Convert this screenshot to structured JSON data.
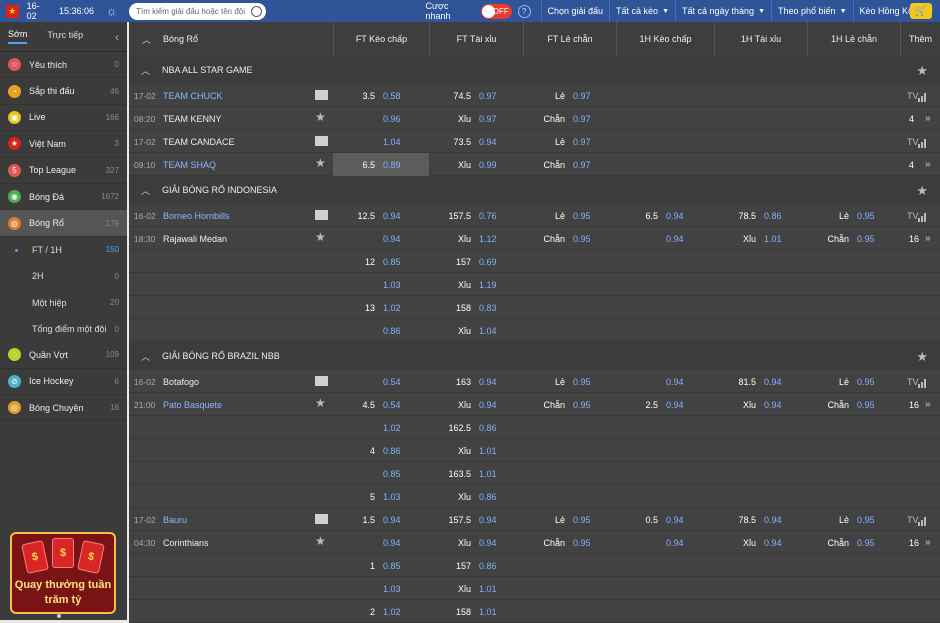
{
  "topbar": {
    "date": "16-02",
    "time": "15:36:06",
    "search_placeholder": "Tìm kiếm giải đấu hoặc tên đội",
    "quick_bet_label": "Cược nhanh",
    "toggle_state": "OFF",
    "menu": [
      {
        "label": "Chọn giải đấu",
        "caret": false
      },
      {
        "label": "Tất cả kèo",
        "caret": true
      },
      {
        "label": "Tất cả ngày tháng",
        "caret": true
      },
      {
        "label": "Theo phổ biến",
        "caret": true
      },
      {
        "label": "Kèo Hồng Kông",
        "caret": true
      }
    ]
  },
  "sidebar": {
    "tabs": [
      "Sớm",
      "Trực tiếp"
    ],
    "items": [
      {
        "label": "Yêu thích",
        "count": "0",
        "icon": "star-icon",
        "color": "#e05656"
      },
      {
        "label": "Sắp thi đấu",
        "count": "46",
        "icon": "clock-icon",
        "color": "#e5a31f"
      },
      {
        "label": "Live",
        "count": "166",
        "icon": "tv-icon",
        "color": "#e6c419"
      },
      {
        "label": "Việt Nam",
        "count": "3",
        "icon": "vietnam-flag-icon",
        "color": "#d8231a"
      },
      {
        "label": "Top League",
        "count": "327",
        "icon": "top-league-icon",
        "color": "#e05656"
      },
      {
        "label": "Bóng Đá",
        "count": "1672",
        "icon": "football-icon",
        "color": "#4caf50"
      },
      {
        "label": "Bóng Rổ",
        "count": "179",
        "icon": "basketball-icon",
        "color": "#e07a30"
      }
    ],
    "subitems": [
      {
        "label": "FT / 1H",
        "count": "150",
        "active": true
      },
      {
        "label": "2H",
        "count": "0",
        "active": false
      },
      {
        "label": "Một hiệp",
        "count": "20",
        "active": false
      },
      {
        "label": "Tổng điểm một đội",
        "count": "0",
        "active": false
      }
    ],
    "items2": [
      {
        "label": "Quần Vợt",
        "count": "109",
        "icon": "tennis-icon",
        "color": "#b8d430"
      },
      {
        "label": "Ice Hockey",
        "count": "6",
        "icon": "ice-hockey-icon",
        "color": "#4cb3c9"
      },
      {
        "label": "Bóng Chuyền",
        "count": "16",
        "icon": "volleyball-icon",
        "color": "#e0a030"
      }
    ],
    "promo": {
      "line1": "Quay thưởng tuần",
      "line2": "trăm tỷ",
      "env_symbol": "$"
    }
  },
  "headers": {
    "sport": "Bóng Rổ",
    "cols": [
      "FT Kèo chấp",
      "FT Tài xỉu",
      "FT Lẻ chẵn",
      "1H Kèo chấp",
      "1H Tài xỉu",
      "1H Lẻ chẵn",
      "Thêm"
    ]
  },
  "leagues": [
    {
      "name": "NBA ALL STAR GAME"
    },
    {
      "name": "GIẢI BÓNG RỔ INDONESIA"
    },
    {
      "name": "GIẢI BÓNG RỔ BRAZIL NBB"
    }
  ],
  "matches": [
    {
      "date": "17-02",
      "time": "08:20",
      "home": "TEAM CHUCK",
      "away": "TEAM KENNY",
      "home_fav": true,
      "away_fav": false,
      "more_count": "4",
      "rows": [
        {
          "hc": "3.5",
          "hco": "0.58",
          "ou": "74.5",
          "ouo": "0.97",
          "oe": "Lẻ",
          "oeo": "0.97"
        },
        {
          "hc": "",
          "hco": "0.96",
          "ou": "Xỉu",
          "ouo": "0.97",
          "oe": "Chẵn",
          "oeo": "0.97"
        }
      ]
    },
    {
      "date": "17-02",
      "time": "09:10",
      "home": "TEAM CANDACE",
      "away": "TEAM SHAQ",
      "home_fav": false,
      "away_fav": true,
      "more_count": "4",
      "rows": [
        {
          "hc": "",
          "hco": "1.04",
          "ou": "73.5",
          "ouo": "0.94",
          "oe": "Lẻ",
          "oeo": "0.97"
        },
        {
          "hc": "6.5",
          "hco": "0.89",
          "ou": "Xỉu",
          "ouo": "0.99",
          "oe": "Chẵn",
          "oeo": "0.97",
          "highlight": true
        }
      ]
    },
    {
      "date": "16-02",
      "time": "18:30",
      "home": "Borneo Hornbills",
      "away": "Rajawali Medan",
      "home_fav": true,
      "away_fav": false,
      "more_count": "16",
      "rows": [
        {
          "hc": "12.5",
          "hco": "0.94",
          "ou": "157.5",
          "ouo": "0.76",
          "oe": "Lẻ",
          "oeo": "0.95",
          "h1hc": "6.5",
          "h1hco": "0.94",
          "h1ou": "78.5",
          "h1ouo": "0.86",
          "h1oe": "Lẻ",
          "h1oeo": "0.95"
        },
        {
          "hc": "",
          "hco": "0.94",
          "ou": "Xỉu",
          "ouo": "1.12",
          "oe": "Chẵn",
          "oeo": "0.95",
          "h1hc": "",
          "h1hco": "0.94",
          "h1ou": "Xỉu",
          "h1ouo": "1.01",
          "h1oe": "Chẵn",
          "h1oeo": "0.95"
        },
        {
          "hc": "12",
          "hco": "0.85",
          "ou": "157",
          "ouo": "0.69"
        },
        {
          "hc": "",
          "hco": "1.03",
          "ou": "Xỉu",
          "ouo": "1.19"
        },
        {
          "hc": "13",
          "hco": "1.02",
          "ou": "158",
          "ouo": "0.83"
        },
        {
          "hc": "",
          "hco": "0.86",
          "ou": "Xỉu",
          "ouo": "1.04"
        }
      ]
    },
    {
      "date": "16-02",
      "time": "21:00",
      "home": "Botafogo",
      "away": "Pato Basquete",
      "home_fav": false,
      "away_fav": true,
      "more_count": "16",
      "rows": [
        {
          "hc": "",
          "hco": "0.54",
          "ou": "163",
          "ouo": "0.94",
          "oe": "Lẻ",
          "oeo": "0.95",
          "h1hc": "",
          "h1hco": "0.94",
          "h1ou": "81.5",
          "h1ouo": "0.94",
          "h1oe": "Lẻ",
          "h1oeo": "0.95"
        },
        {
          "hc": "4.5",
          "hco": "0.54",
          "ou": "Xỉu",
          "ouo": "0.94",
          "oe": "Chẵn",
          "oeo": "0.95",
          "h1hc": "2.5",
          "h1hco": "0.94",
          "h1ou": "Xỉu",
          "h1ouo": "0.94",
          "h1oe": "Chẵn",
          "h1oeo": "0.95"
        },
        {
          "hc": "",
          "hco": "1.02",
          "ou": "162.5",
          "ouo": "0.86"
        },
        {
          "hc": "4",
          "hco": "0.86",
          "ou": "Xỉu",
          "ouo": "1.01"
        },
        {
          "hc": "",
          "hco": "0.85",
          "ou": "163.5",
          "ouo": "1.01"
        },
        {
          "hc": "5",
          "hco": "1.03",
          "ou": "Xỉu",
          "ouo": "0.86"
        }
      ]
    },
    {
      "date": "17-02",
      "time": "04:30",
      "home": "Bauru",
      "away": "Corinthians",
      "home_fav": true,
      "away_fav": false,
      "more_count": "16",
      "rows": [
        {
          "hc": "1.5",
          "hco": "0.94",
          "ou": "157.5",
          "ouo": "0.94",
          "oe": "Lẻ",
          "oeo": "0.95",
          "h1hc": "0.5",
          "h1hco": "0.94",
          "h1ou": "78.5",
          "h1ouo": "0.94",
          "h1oe": "Lẻ",
          "h1oeo": "0.95"
        },
        {
          "hc": "",
          "hco": "0.94",
          "ou": "Xỉu",
          "ouo": "0.94",
          "oe": "Chẵn",
          "oeo": "0.95",
          "h1hc": "",
          "h1hco": "0.94",
          "h1ou": "Xỉu",
          "h1ouo": "0.94",
          "h1oe": "Chẵn",
          "h1oeo": "0.95"
        },
        {
          "hc": "1",
          "hco": "0.85",
          "ou": "157",
          "ouo": "0.86"
        },
        {
          "hc": "",
          "hco": "1.03",
          "ou": "Xỉu",
          "ouo": "1.01"
        },
        {
          "hc": "2",
          "hco": "1.02",
          "ou": "158",
          "ouo": "1.01"
        }
      ]
    }
  ],
  "tv_label": "TV",
  "colors": {
    "topbar": "#2f5497",
    "odds": "#7fb3ff",
    "accent": "#5aa0ff"
  }
}
